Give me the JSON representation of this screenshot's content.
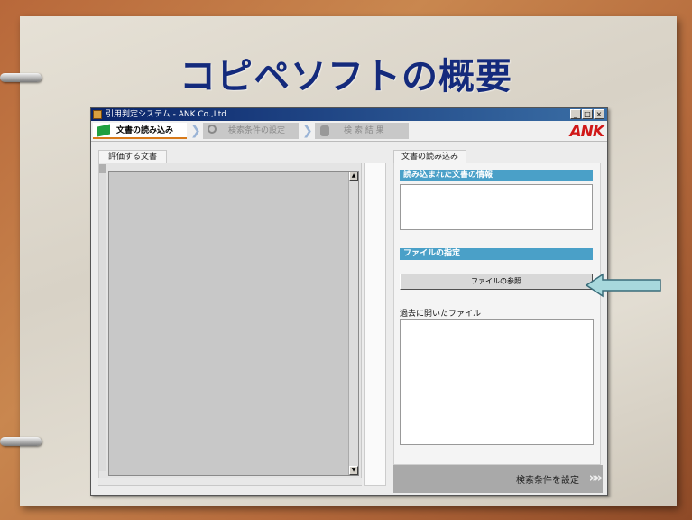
{
  "slide": {
    "title": "コピペソフトの概要"
  },
  "window": {
    "title": "引用判定システム - ANK Co.,Ltd",
    "controls": [
      "_",
      "□",
      "×"
    ]
  },
  "toolbar": {
    "steps": [
      {
        "label": "文書の読み込み",
        "icon": "book-icon",
        "state": "active"
      },
      {
        "label": "検索条件の設定",
        "icon": "magnifier-icon",
        "state": "inactive"
      },
      {
        "label": "検 索 結 果",
        "icon": "result-icon",
        "state": "inactive"
      }
    ],
    "step_separator": "❯",
    "logo": "ANK"
  },
  "left_panel": {
    "tab_label": "評価する文書",
    "scroll_up": "▲",
    "scroll_down": "▼"
  },
  "right_panel": {
    "tab_label": "文書の読み込み",
    "loaded_info_header": "読み込まれた文書の情報",
    "file_spec_header": "ファイルの指定",
    "browse_button": "ファイルの参照",
    "recent_label": "過去に開いたファイル",
    "next_button": "検索条件を設定",
    "next_arrows": "»»"
  },
  "colors": {
    "title_text": "#142a7c",
    "section_header": "#4aa0c8",
    "active_step_underline": "#d87a1a",
    "logo": "#d01818",
    "pointer_arrow": "#a7d8dc"
  }
}
